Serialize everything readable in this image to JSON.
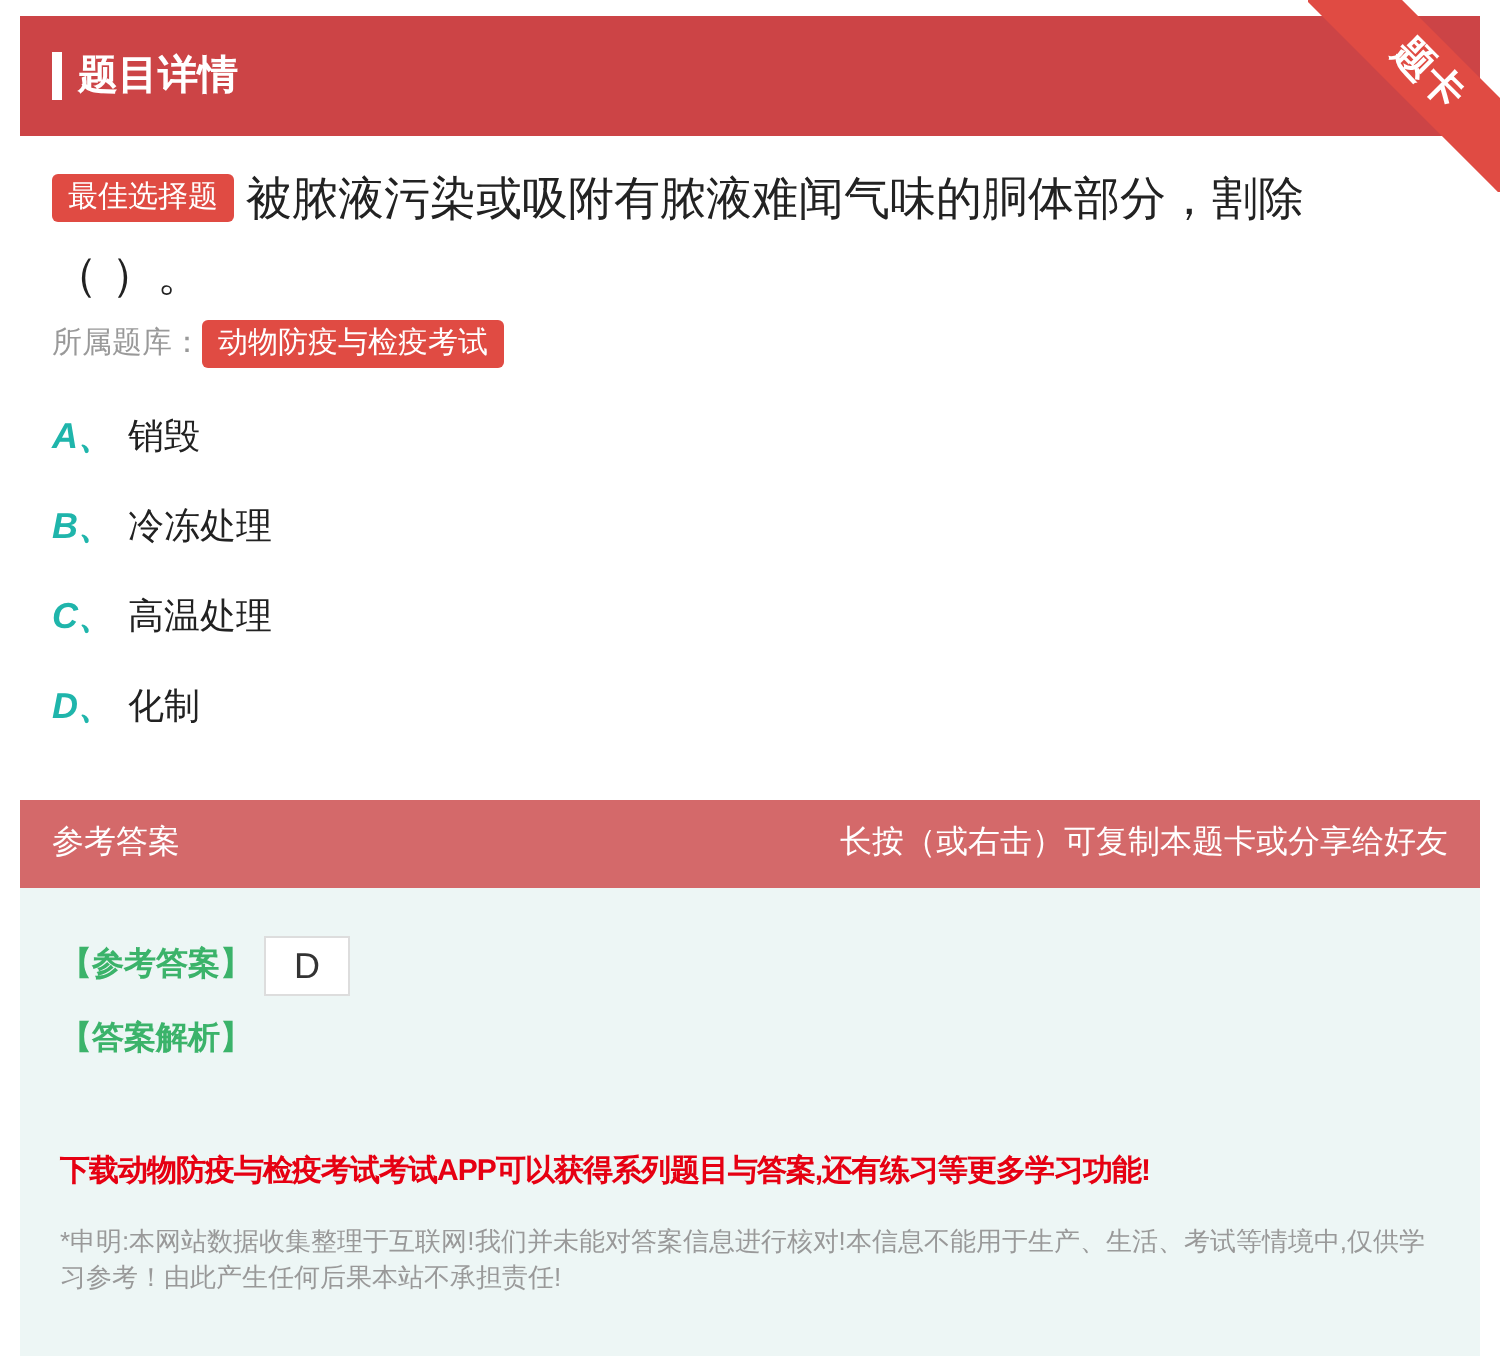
{
  "header": {
    "title": "题目详情",
    "ribbon": "题卡"
  },
  "question": {
    "type_badge": "最佳选择题",
    "text_lines": [
      "被脓液污染或吸附有脓液难闻气味的胴体部分，割除",
      "（ ）。"
    ],
    "library_label": "所属题库：",
    "library": "动物防疫与检疫考试"
  },
  "options": [
    {
      "letter": "A、",
      "text": "销毁"
    },
    {
      "letter": "B、",
      "text": "冷冻处理"
    },
    {
      "letter": "C、",
      "text": "高温处理"
    },
    {
      "letter": "D、",
      "text": "化制"
    }
  ],
  "answer_bar": {
    "title": "参考答案",
    "hint": "长按（或右击）可复制本题卡或分享给好友"
  },
  "answer": {
    "label": "【参考答案】",
    "value": "D",
    "analysis_label": "【答案解析】"
  },
  "promo": "下载动物防疫与检疫考试考试APP可以获得系列题目与答案,还有练习等更多学习功能!",
  "disclaimer": "*申明:本网站数据收集整理于互联网!我们并未能对答案信息进行核对!本信息不能用于生产、生活、考试等情境中,仅供学习参考！由此产生任何后果本站不承担责任!"
}
